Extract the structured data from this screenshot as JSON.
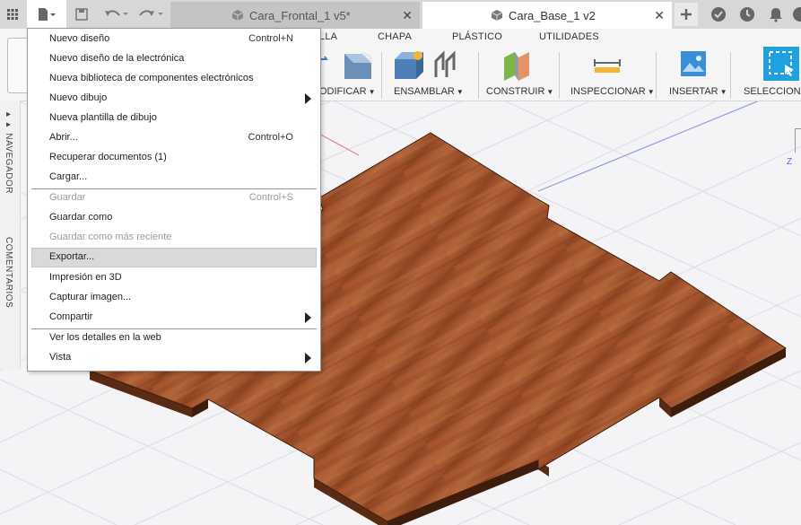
{
  "topbar": {
    "tabs": [
      {
        "label": "Cara_Frontal_1 v5*",
        "active": false
      },
      {
        "label": "Cara_Base_1 v2",
        "active": true
      }
    ],
    "icons": [
      "grid-icon",
      "file-icon",
      "save-icon",
      "undo-icon",
      "redo-icon",
      "add-tab-icon",
      "extensions-icon",
      "job-status-icon",
      "notifications-icon"
    ]
  },
  "ribbon": {
    "tabs": [
      "LLA",
      "CHAPA",
      "PLÁSTICO",
      "UTILIDADES"
    ],
    "groups": [
      "ODIFICAR",
      "ENSAMBLAR",
      "CONSTRUIR",
      "INSPECCIONAR",
      "INSERTAR",
      "SELECCIONA"
    ]
  },
  "sidepanel": {
    "navigator": "NAVEGADOR",
    "comments": "COMENTARIOS"
  },
  "viewcube": {
    "axis": "Z"
  },
  "menu": {
    "items": [
      {
        "label": "Nuevo diseño",
        "shortcut": "Control+N",
        "disabled": false,
        "submenu": false
      },
      {
        "label": "Nuevo diseño de la electrónica",
        "shortcut": "",
        "disabled": false,
        "submenu": false
      },
      {
        "label": "Nueva biblioteca de componentes electrónicos",
        "shortcut": "",
        "disabled": false,
        "submenu": false
      },
      {
        "label": "Nuevo dibujo",
        "shortcut": "",
        "disabled": false,
        "submenu": true
      },
      {
        "label": "Nueva plantilla de dibujo",
        "shortcut": "",
        "disabled": false,
        "submenu": false
      },
      {
        "label": "Abrir...",
        "shortcut": "Control+O",
        "disabled": false,
        "submenu": false
      },
      {
        "label": "Recuperar documentos (1)",
        "shortcut": "",
        "disabled": false,
        "submenu": false
      },
      {
        "label": "Cargar...",
        "shortcut": "",
        "disabled": false,
        "submenu": false
      },
      {
        "label": "Guardar",
        "shortcut": "Control+S",
        "disabled": true,
        "submenu": false
      },
      {
        "label": "Guardar como",
        "shortcut": "",
        "disabled": false,
        "submenu": false
      },
      {
        "label": "Guardar como más reciente",
        "shortcut": "",
        "disabled": true,
        "submenu": false
      },
      {
        "label": "Exportar...",
        "shortcut": "",
        "disabled": false,
        "submenu": false,
        "highlighted": true
      },
      {
        "label": "Impresión en 3D",
        "shortcut": "",
        "disabled": false,
        "submenu": false
      },
      {
        "label": "Capturar imagen...",
        "shortcut": "",
        "disabled": false,
        "submenu": false
      },
      {
        "label": "Compartir",
        "shortcut": "",
        "disabled": false,
        "submenu": true
      },
      {
        "label": "Ver los detalles en la web",
        "shortcut": "",
        "disabled": false,
        "submenu": false
      },
      {
        "label": "Vista",
        "shortcut": "",
        "disabled": false,
        "submenu": true
      }
    ]
  },
  "colors": {
    "wood": "#a2522c",
    "wood_dark": "#6e3a1e",
    "highlight": "#d9d9d9",
    "select_blue": "#1fa0e0"
  }
}
